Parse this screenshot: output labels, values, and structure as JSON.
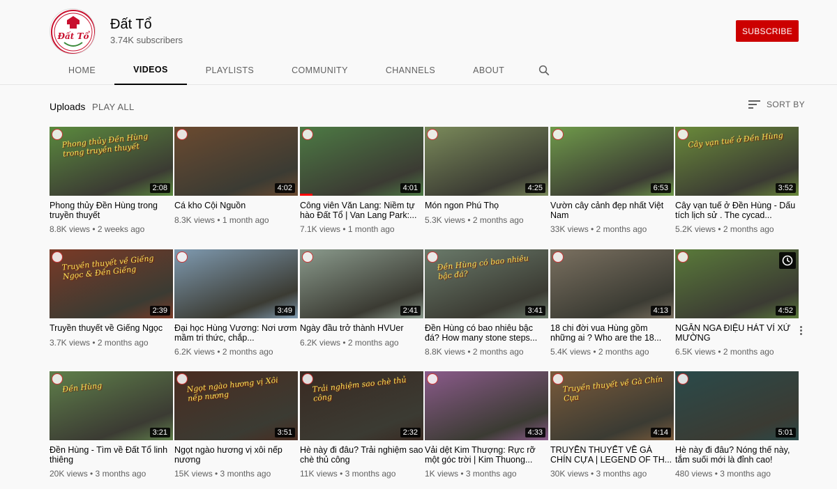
{
  "channel": {
    "name": "Đất Tổ",
    "subscribers": "3.74K subscribers",
    "logo_text": "Đất Tổ",
    "subscribe_label": "SUBSCRIBE"
  },
  "tabs": [
    {
      "label": "HOME"
    },
    {
      "label": "VIDEOS"
    },
    {
      "label": "PLAYLISTS"
    },
    {
      "label": "COMMUNITY"
    },
    {
      "label": "CHANNELS"
    },
    {
      "label": "ABOUT"
    }
  ],
  "section": {
    "uploads_label": "Uploads",
    "play_all_label": "PLAY ALL",
    "sort_label": "SORT BY"
  },
  "colors": {
    "subscribe": "#cc0000",
    "accent_text": "#030303",
    "secondary_text": "#606060"
  },
  "videos": [
    {
      "title": "Phong thủy Đền Hùng trong truyền thuyết",
      "meta": "8.8K views • 2 weeks ago",
      "duration": "2:08",
      "overlay": "Phong thủy Đền Hùng trong truyền thuyết",
      "thumb_color": "#5b8a3e"
    },
    {
      "title": "Cá kho Cội Nguồn",
      "meta": "8.3K views • 1 month ago",
      "duration": "4:02",
      "overlay": "",
      "thumb_color": "#6b4a30"
    },
    {
      "title": "Công viên Văn Lang: Niềm tự hào Đất Tổ | Van Lang Park:...",
      "meta": "7.1K views • 1 month ago",
      "duration": "4:01",
      "overlay": "",
      "thumb_color": "#4d7a44"
    },
    {
      "title": "Món ngon Phú Thọ",
      "meta": "5.3K views • 2 months ago",
      "duration": "4:25",
      "overlay": "",
      "thumb_color": "#7a8a5a"
    },
    {
      "title": "Vườn cây cảnh đẹp nhất Việt Nam",
      "meta": "33K views • 2 months ago",
      "duration": "6:53",
      "overlay": "",
      "thumb_color": "#6f9a4a"
    },
    {
      "title": "Cây vạn tuế ở Đền Hùng - Dấu tích lịch sử . The cycad...",
      "meta": "5.2K views • 2 months ago",
      "duration": "3:52",
      "overlay": "Cây vạn tuế ở Đền Hùng",
      "thumb_color": "#6a8a3a"
    },
    {
      "title": "Truyền thuyết về Giếng Ngọc",
      "meta": "3.7K views • 2 months ago",
      "duration": "2:39",
      "overlay": "Truyền thuyết về Giếng Ngọc & Đền Giếng",
      "thumb_color": "#7a3a26"
    },
    {
      "title": "Đại học Hùng Vương: Nơi ươm mầm tri thức, chắp...",
      "meta": "6.2K views • 2 months ago",
      "duration": "3:49",
      "overlay": "",
      "thumb_color": "#7f9ab0"
    },
    {
      "title": "Ngày đầu trở thành HVUer",
      "meta": "6.2K views • 2 months ago",
      "duration": "2:41",
      "overlay": "",
      "thumb_color": "#8a9a8c"
    },
    {
      "title": "Đền Hùng có bao nhiêu bậc đá? How many stone steps...",
      "meta": "8.8K views • 2 months ago",
      "duration": "3:41",
      "overlay": "Đền Hùng có bao nhiêu bậc đá?",
      "thumb_color": "#6a7a6a"
    },
    {
      "title": "18 chi đời vua Hùng gồm những ai ? Who are the 18...",
      "meta": "5.4K views • 2 months ago",
      "duration": "4:13",
      "overlay": "",
      "thumb_color": "#7a7060"
    },
    {
      "title": "NGÂN NGA ĐIỆU HÁT VÍ XỨ MƯỜNG",
      "meta": "6.5K views • 2 months ago",
      "duration": "4:52",
      "overlay": "",
      "thumb_color": "#5a7a3a"
    },
    {
      "title": "Đền Hùng - Tìm về Đất Tổ linh thiêng",
      "meta": "20K views • 3 months ago",
      "duration": "3:21",
      "overlay": "Đền Hùng",
      "thumb_color": "#5f7f4a"
    },
    {
      "title": "Ngọt ngào hương vị xôi nếp nương",
      "meta": "15K views • 3 months ago",
      "duration": "3:51",
      "overlay": "Ngọt ngào hương vị Xôi nếp nương",
      "thumb_color": "#4a2c20"
    },
    {
      "title": "Hè này đi đâu? Trải nghiệm sao chè thủ công",
      "meta": "11K views • 3 months ago",
      "duration": "2:32",
      "overlay": "Trải nghiệm sao chè thủ công",
      "thumb_color": "#3a2a22"
    },
    {
      "title": "Vải dệt Kim Thượng: Rực rỡ một góc trời | Kim Thuong...",
      "meta": "1K views • 3 months ago",
      "duration": "4:33",
      "overlay": "",
      "thumb_color": "#8a5a8a"
    },
    {
      "title": "TRUYỀN THUYẾT VỀ GÀ CHÍN CỰA | LEGEND OF TH...",
      "meta": "30K views • 3 months ago",
      "duration": "4:14",
      "overlay": "Truyền thuyết về Gà Chín Cựa",
      "thumb_color": "#7a5a3a"
    },
    {
      "title": "Hè này đi đâu? Nóng thế này, tắm suối mới là đỉnh cao!",
      "meta": "480 views • 3 months ago",
      "duration": "5:01",
      "overlay": "",
      "thumb_color": "#2a4a4a"
    }
  ]
}
